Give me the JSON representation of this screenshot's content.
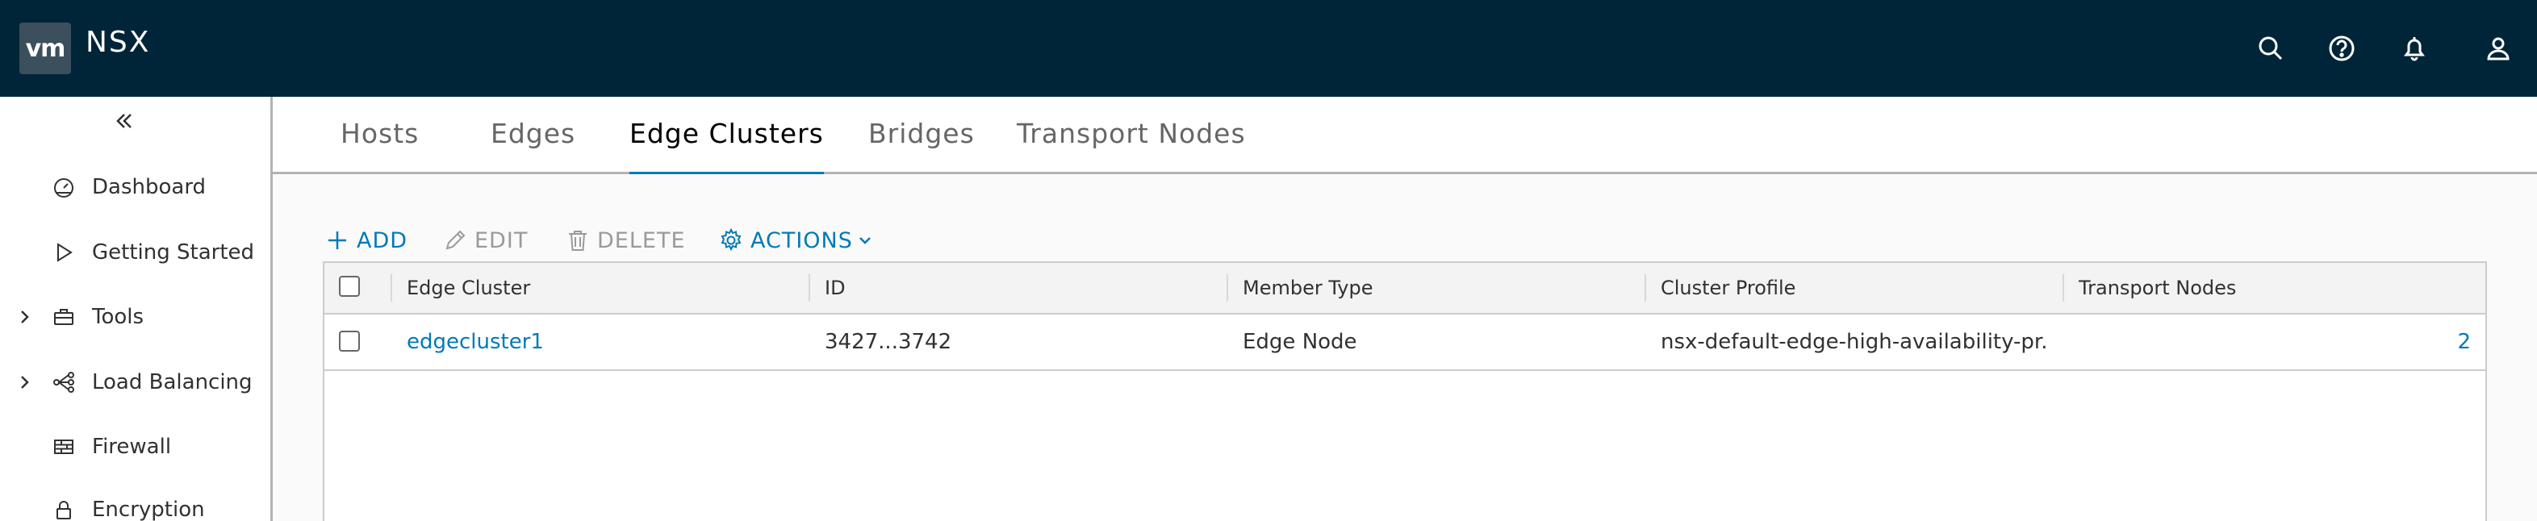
{
  "header": {
    "logo_text": "vm",
    "app_name": "NSX",
    "icons": [
      "search-icon",
      "help-icon",
      "bell-icon",
      "user-icon"
    ],
    "bg_color": "#002538"
  },
  "sidebar": {
    "items": [
      {
        "label": "Dashboard",
        "icon": "dashboard-icon",
        "expandable": false
      },
      {
        "label": "Getting Started",
        "icon": "play-icon",
        "expandable": false
      },
      {
        "label": "Tools",
        "icon": "toolbox-icon",
        "expandable": true
      },
      {
        "label": "Load Balancing",
        "icon": "load-balancer-icon",
        "expandable": true
      },
      {
        "label": "Firewall",
        "icon": "firewall-icon",
        "expandable": false
      },
      {
        "label": "Encryption",
        "icon": "lock-icon",
        "expandable": false
      }
    ]
  },
  "tabs": [
    {
      "label": "Hosts",
      "active": false
    },
    {
      "label": "Edges",
      "active": false
    },
    {
      "label": "Edge Clusters",
      "active": true
    },
    {
      "label": "Bridges",
      "active": false
    },
    {
      "label": "Transport Nodes",
      "active": false
    }
  ],
  "toolbar": {
    "add_label": "ADD",
    "edit_label": "EDIT",
    "delete_label": "DELETE",
    "actions_label": "ACTIONS"
  },
  "grid": {
    "columns": [
      "Edge Cluster",
      "ID",
      "Member Type",
      "Cluster Profile",
      "Transport Nodes"
    ],
    "rows": [
      {
        "edge_cluster": "edgecluster1",
        "id": "3427...3742",
        "member_type": "Edge Node",
        "cluster_profile": "nsx-default-edge-high-availability-pr...",
        "transport_nodes": "2"
      }
    ]
  },
  "colors": {
    "accent": "#0079b8",
    "header": "#002538"
  }
}
